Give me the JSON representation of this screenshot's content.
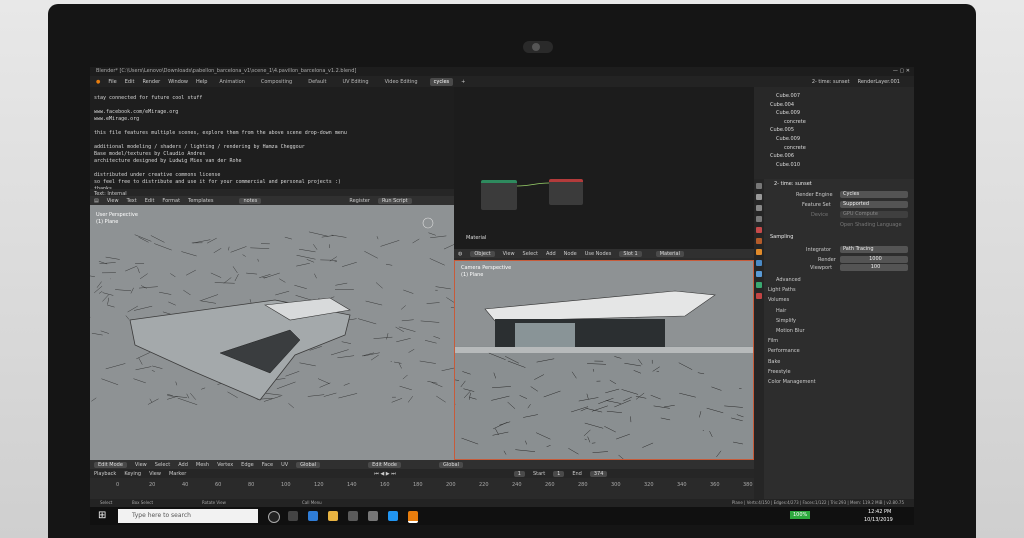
{
  "window": {
    "title": "Blender* [C:\\Users\\Lenovo\\Downloads\\pabellon_barcelona_v1\\scene_1\\4.pavillon_barcelona_v1.2.blend]"
  },
  "menu": [
    "File",
    "Edit",
    "Render",
    "Window",
    "Help"
  ],
  "workspaces": [
    "Animation",
    "Compositing",
    "Default",
    "UV Editing",
    "Video Editing",
    "cycles"
  ],
  "scene": {
    "name": "2- time: sunset",
    "layer": "RenderLayer.001"
  },
  "text_editor": {
    "lines": [
      "stay connected for future cool stuff",
      "",
      "www.facebook.com/eMirage.org",
      "www.eMirage.org",
      "",
      "this file features multiple scenes, explore them from the above scene drop-down menu",
      "",
      "additional modeling / shaders / lighting / rendering by Hamza Cheggour",
      "Base model/textures by Claudio Andres",
      "architecture designed by Ludwig Mies van der Rohe",
      "",
      "distributed under creative commons license",
      "so feel free to distribute and use it for your commercial and personal projects :)",
      "thanks"
    ],
    "file": "Text: Internal",
    "header": [
      "View",
      "Text",
      "Edit",
      "Format",
      "Templates"
    ],
    "datablock": "notes",
    "register": "Register",
    "run": "Run Script"
  },
  "viewport_left": {
    "label": "User Perspective",
    "sub": "(1) Plane",
    "mode": "Edit Mode",
    "menus": [
      "View",
      "Select",
      "Add",
      "Mesh",
      "Vertex",
      "Edge",
      "Face",
      "UV"
    ],
    "orient": "Global"
  },
  "node_editor": {
    "menus": [
      "Object",
      "View",
      "Select",
      "Add",
      "Node"
    ],
    "use_nodes": "Use Nodes",
    "slot": "Slot 1",
    "material": "Material",
    "label": "Material"
  },
  "viewport_right": {
    "label": "Camera Perspective",
    "sub": "(1) Plane",
    "mode": "Edit Mode",
    "orient": "Global"
  },
  "outliner": [
    "Cube.007",
    "Cube.004",
    "Cube.009",
    "concrete",
    "Cube.005",
    "Cube.009",
    "concrete",
    "Cube.006",
    "Cube.010"
  ],
  "properties": {
    "scene": "2- time: sunset",
    "render_engine_label": "Render Engine",
    "render_engine": "Cycles",
    "feature_set_label": "Feature Set",
    "feature_set": "Supported",
    "device_label": "Device",
    "device": "GPU Compute",
    "osl": "Open Shading Language",
    "sampling": "Sampling",
    "integrator_label": "Integrator",
    "integrator": "Path Tracing",
    "render_label": "Render",
    "render": "1000",
    "viewport_label": "Viewport",
    "viewport": "100",
    "panels": [
      "Advanced",
      "Light Paths",
      "Volumes",
      "Hair",
      "Simplify",
      "Motion Blur",
      "Film",
      "Performance",
      "Bake",
      "Freestyle",
      "Color Management"
    ]
  },
  "timeline": {
    "menus": [
      "Playback",
      "Keying",
      "View",
      "Marker"
    ],
    "ticks": [
      "0",
      "20",
      "40",
      "60",
      "80",
      "100",
      "120",
      "140",
      "160",
      "180",
      "200",
      "220",
      "240",
      "260",
      "280",
      "300",
      "320",
      "340",
      "360",
      "380"
    ],
    "frame": "1",
    "start_label": "Start",
    "start": "1",
    "end_label": "End",
    "end": "374"
  },
  "status": {
    "left": [
      "Select",
      "Box Select",
      "Rotate View",
      "Call Menu"
    ],
    "right": "Plane | Verts:4/150 | Edges:4/273 | Faces:1/122 | Tris:293 | Mem: 119.2 MiB | v2.80.75"
  },
  "taskbar": {
    "search": "Type here to search",
    "battery": "100%",
    "time": "12:42 PM",
    "date": "10/13/2019"
  },
  "colors": {
    "accent": "#4772b3",
    "selected_border": "#c75b3a",
    "viewport_bg": "#8e9294"
  }
}
